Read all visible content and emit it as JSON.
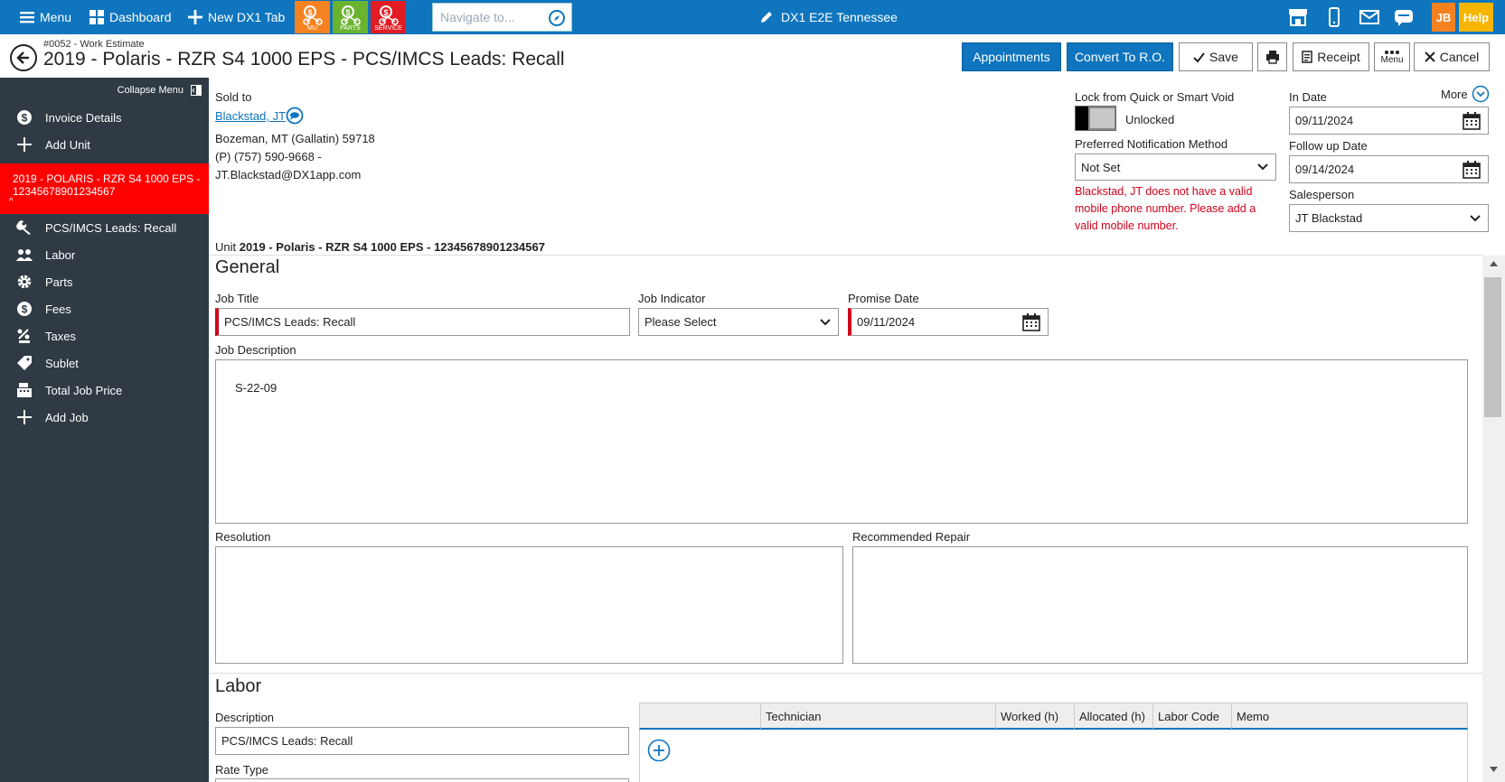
{
  "topbar": {
    "menu_label": "Menu",
    "dashboard_label": "Dashboard",
    "new_tab_label": "New DX1 Tab",
    "quick_buttons": [
      {
        "label": "MU",
        "color": "#f58220"
      },
      {
        "label": "PARTS",
        "color": "#6ab32e"
      },
      {
        "label": "SERVICE",
        "color": "#e31b23"
      }
    ],
    "navigate_placeholder": "Navigate to...",
    "dealer_title": "DX1 E2E Tennessee",
    "user_initials": "JB",
    "help_label": "Help",
    "accent": "#0e75be"
  },
  "header": {
    "breadcrumb": "#0052 - Work Estimate",
    "title": "2019 - Polaris - RZR S4 1000 EPS - PCS/IMCS Leads: Recall",
    "buttons": {
      "appointments": "Appointments",
      "convert": "Convert To R.O.",
      "save": "Save",
      "receipt": "Receipt",
      "menu": "Menu",
      "cancel": "Cancel"
    }
  },
  "sidebar": {
    "collapse_label": "Collapse Menu",
    "items_top": [
      {
        "label": "Invoice Details",
        "icon": "dollar-circle-icon"
      },
      {
        "label": "Add Unit",
        "icon": "plus-icon"
      }
    ],
    "unit_label": "2019 - POLARIS - RZR S4 1000 EPS - 12345678901234567",
    "unit_caret": "^",
    "items": [
      {
        "label": "PCS/IMCS Leads: Recall",
        "icon": "wrench-icon"
      },
      {
        "label": "Labor",
        "icon": "workers-icon"
      },
      {
        "label": "Parts",
        "icon": "gear-icon"
      },
      {
        "label": "Fees",
        "icon": "dollar-circle-icon"
      },
      {
        "label": "Taxes",
        "icon": "tax-icon"
      },
      {
        "label": "Sublet",
        "icon": "tag-icon"
      },
      {
        "label": "Total Job Price",
        "icon": "register-icon"
      },
      {
        "label": "Add Job",
        "icon": "plus-icon"
      }
    ]
  },
  "customer": {
    "sold_to_label": "Sold to",
    "name": "Blackstad, JT",
    "address": "Bozeman, MT (Gallatin) 59718",
    "phone": "(P) (757) 590-9668 -",
    "email": "JT.Blackstad@DX1app.com"
  },
  "lock": {
    "label": "Lock from Quick or Smart Void",
    "state": "Unlocked"
  },
  "notification": {
    "label": "Preferred Notification Method",
    "value": "Not Set",
    "error": "Blackstad, JT does not have a valid mobile phone number. Please add a valid mobile number."
  },
  "dates": {
    "more_label": "More",
    "in_date_label": "In Date",
    "in_date": "09/11/2024",
    "follow_up_label": "Follow up Date",
    "follow_up": "09/14/2024",
    "salesperson_label": "Salesperson",
    "salesperson": "JT Blackstad"
  },
  "unit_line": {
    "prefix": "Unit",
    "value": "2019 - Polaris - RZR S4 1000 EPS - 12345678901234567"
  },
  "general": {
    "heading": "General",
    "job_title_label": "Job Title",
    "job_title": "PCS/IMCS Leads: Recall",
    "job_indicator_label": "Job Indicator",
    "job_indicator": "Please Select",
    "promise_date_label": "Promise Date",
    "promise_date": "09/11/2024",
    "job_description_label": "Job Description",
    "job_description": "S-22-09",
    "resolution_label": "Resolution",
    "recommended_label": "Recommended Repair"
  },
  "labor": {
    "heading": "Labor",
    "description_label": "Description",
    "description": "PCS/IMCS Leads: Recall",
    "rate_type_label": "Rate Type",
    "columns": [
      "Technician",
      "Worked (h)",
      "Allocated (h)",
      "Labor Code",
      "Memo"
    ]
  }
}
